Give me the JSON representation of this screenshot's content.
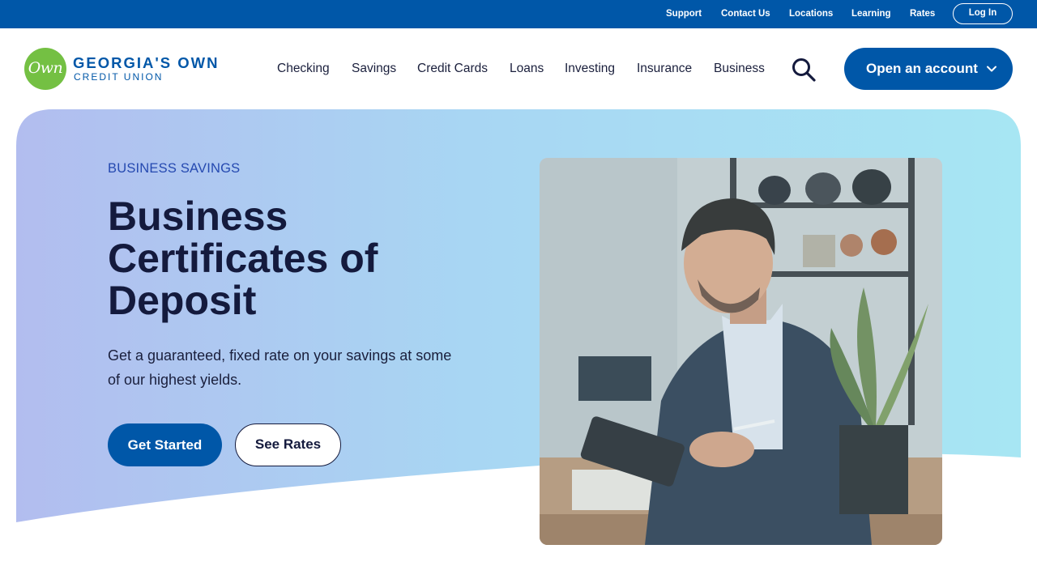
{
  "utility_nav": {
    "links": [
      "Support",
      "Contact Us",
      "Locations",
      "Learning",
      "Rates"
    ],
    "login_label": "Log In"
  },
  "header": {
    "logo": {
      "badge_text": "Own",
      "title": "GEORGIA'S OWN",
      "subtitle": "CREDIT UNION"
    },
    "nav": [
      "Checking",
      "Savings",
      "Credit Cards",
      "Loans",
      "Investing",
      "Insurance",
      "Business"
    ],
    "search_icon": "search-icon",
    "cta_label": "Open an account",
    "cta_icon": "chevron-down-icon"
  },
  "hero": {
    "eyebrow": "BUSINESS SAVINGS",
    "title": "Business Certificates of Deposit",
    "description": "Get a guaranteed, fixed rate on your savings at some of our highest yields.",
    "primary_button": "Get Started",
    "secondary_button": "See Rates"
  },
  "colors": {
    "brand_blue": "#0057a8",
    "logo_green": "#74c043",
    "heading_navy": "#141a3d",
    "eyebrow_blue": "#2549b0",
    "hero_gradient_start": "#b2bdef",
    "hero_gradient_end": "#a7e6f3"
  }
}
